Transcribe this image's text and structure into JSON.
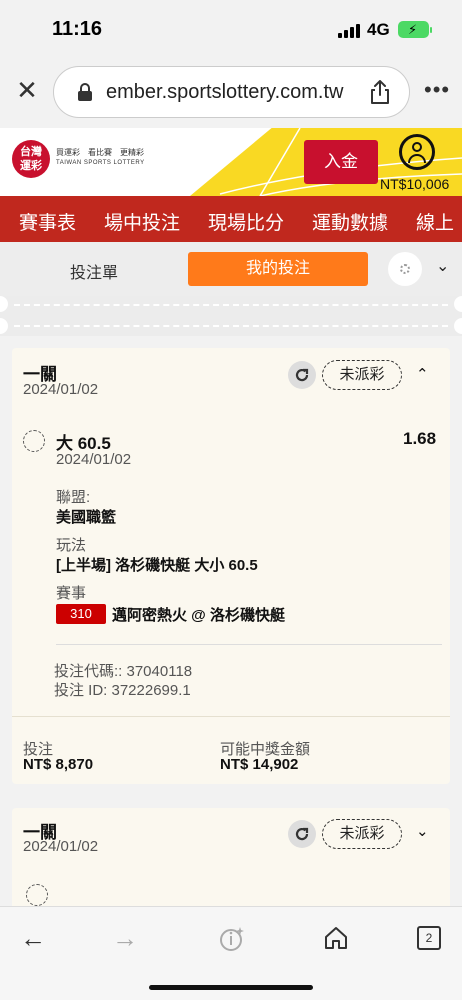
{
  "status_bar": {
    "time": "11:16",
    "network": "4G"
  },
  "browser": {
    "url": "ember.sportslottery.com.tw",
    "tab_count": "2"
  },
  "site": {
    "logo_text": "台灣\n運彩",
    "logo_line1": "買運彩　看比賽　更精彩",
    "logo_line2": "TAIWAN SPORTS LOTTERY",
    "deposit_label": "入金",
    "balance": "NT$10,006",
    "nav": [
      "賽事表",
      "場中投注",
      "現場比分",
      "運動數據",
      "線上"
    ]
  },
  "tabs": {
    "bet_slip": "投注單",
    "my_bets": "我的投注"
  },
  "cards": [
    {
      "title": "一關",
      "date": "2024/01/02",
      "status": "未派彩",
      "selection": "大 60.5",
      "selection_date": "2024/01/02",
      "odds": "1.68",
      "league_label": "聯盟:",
      "league": "美國職籃",
      "market_label": "玩法",
      "market": "[上半場] 洛杉磯快艇 大小 60.5",
      "event_label": "賽事",
      "event_code": "310",
      "event": "邁阿密熱火 @ 洛杉磯快艇",
      "bet_code": "投注代碼:: 37040118",
      "bet_id": "投注 ID: 37222699.1",
      "stake_label": "投注",
      "stake": "NT$ 8,870",
      "payout_label": "可能中獎金額",
      "payout": "NT$ 14,902"
    },
    {
      "title": "一關",
      "date": "2024/01/02",
      "status": "未派彩"
    }
  ]
}
